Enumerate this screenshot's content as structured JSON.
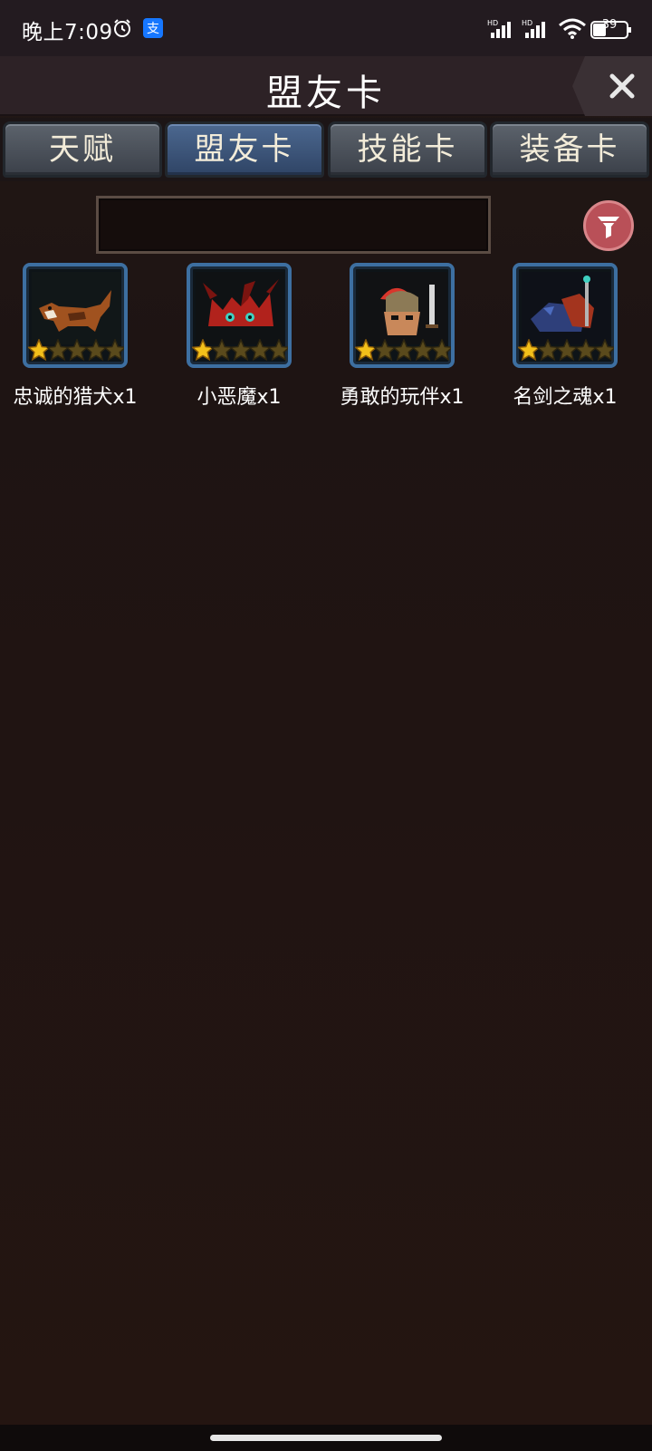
{
  "status_bar": {
    "time": "晚上7:09",
    "battery": "39"
  },
  "header": {
    "title": "盟友卡"
  },
  "tabs": [
    {
      "label": "天赋",
      "active": false
    },
    {
      "label": "盟友卡",
      "active": true
    },
    {
      "label": "技能卡",
      "active": false
    },
    {
      "label": "装备卡",
      "active": false
    }
  ],
  "search": {
    "value": "",
    "placeholder": ""
  },
  "cards": [
    {
      "name": "忠诚的猎犬x1",
      "stars": 1,
      "max_stars": 5,
      "icon": "hound-icon"
    },
    {
      "name": "小恶魔x1",
      "stars": 1,
      "max_stars": 5,
      "icon": "imp-icon"
    },
    {
      "name": "勇敢的玩伴x1",
      "stars": 1,
      "max_stars": 5,
      "icon": "goblin-warrior-icon"
    },
    {
      "name": "名剑之魂x1",
      "stars": 1,
      "max_stars": 5,
      "icon": "sword-spirit-icon"
    }
  ],
  "colors": {
    "accent_tab": "#3f5a82",
    "card_border": "#3d6fa1",
    "filter_button": "#b95058",
    "star_active": "#f3c01a"
  }
}
